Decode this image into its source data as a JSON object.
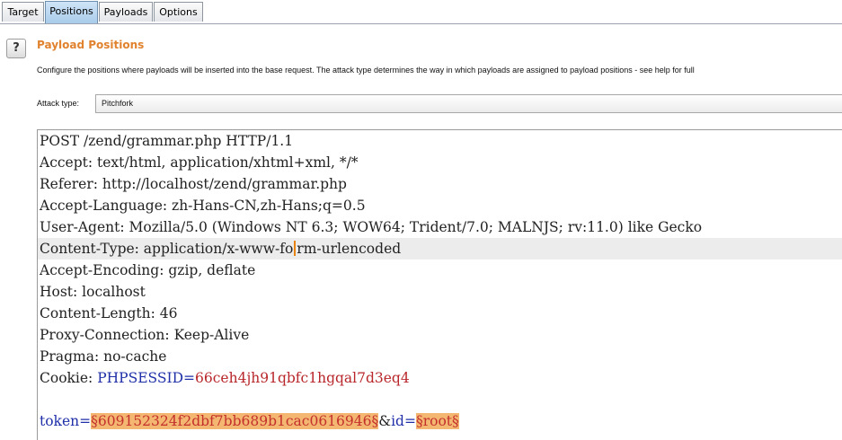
{
  "tabs": [
    {
      "label": "Target",
      "active": false
    },
    {
      "label": "Positions",
      "active": true
    },
    {
      "label": "Payloads",
      "active": false
    },
    {
      "label": "Options",
      "active": false
    }
  ],
  "help": {
    "label": "?"
  },
  "section": {
    "title": "Payload Positions",
    "description": "Configure the positions where payloads will be inserted into the base request. The attack type determines the way in which payloads are assigned to payload positions - see help for full"
  },
  "attack": {
    "label": "Attack type:",
    "value": "Pitchfork"
  },
  "request": {
    "line1": "POST /zend/grammar.php HTTP/1.1",
    "line2": "Accept: text/html, application/xhtml+xml, */*",
    "line3": "Referer: http://localhost/zend/grammar.php",
    "line4": "Accept-Language: zh-Hans-CN,zh-Hans;q=0.5",
    "line5": "User-Agent: Mozilla/5.0 (Windows NT 6.3; WOW64; Trident/7.0; MALNJS; rv:11.0) like Gecko",
    "line6_pre": "Content-Type: application/x-www-fo",
    "line6_post": "rm-urlencoded",
    "line7": "Accept-Encoding: gzip, deflate",
    "line8": "Host: localhost",
    "line9": "Content-Length: 46",
    "line10": "Proxy-Connection: Keep-Alive",
    "line11": "Pragma: no-cache",
    "cookie_label": "Cookie: ",
    "cookie_name": "PHPSESSID",
    "cookie_eq": "=",
    "cookie_value": "66ceh4jh91qbfc1hgqal7d3eq4",
    "body_token_name": "token",
    "body_eq1": "=",
    "body_token_payload": "§609152324f2dbf7bb689b1cac0616946§",
    "body_amp": "&",
    "body_id_name": "id",
    "body_eq2": "=",
    "body_id_payload": "§root§"
  }
}
